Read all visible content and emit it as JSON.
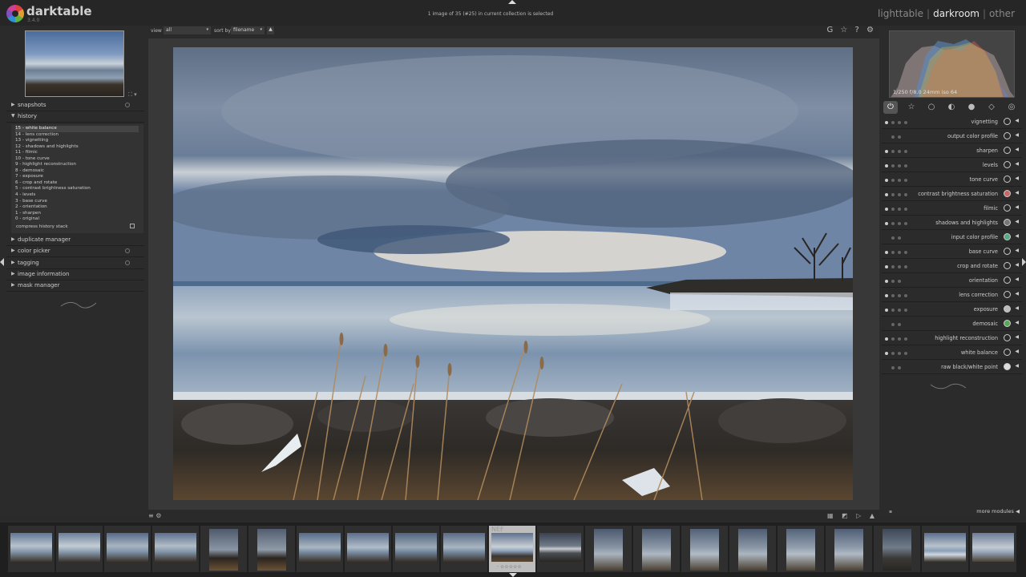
{
  "header": {
    "app_name": "darktable",
    "app_version": "3.4.0",
    "status": "1 image of 35 (#25) in current collection is selected",
    "views": [
      "lighttable",
      "darkroom",
      "other"
    ],
    "active_view": "darkroom"
  },
  "left_panel": {
    "snapshots_label": "snapshots",
    "history_label": "history",
    "history_items": [
      "15 - white balance",
      "14 - lens correction",
      "13 - vignetting",
      "12 - shadows and highlights",
      "11 - filmic",
      "10 - tone curve",
      "9 - highlight reconstruction",
      "8 - demosaic",
      "7 - exposure",
      "6 - crop and rotate",
      "5 - contrast brightness saturation",
      "4 - levels",
      "3 - base curve",
      "2 - orientation",
      "1 - sharpen",
      "0 - original"
    ],
    "compress_label": "compress history stack",
    "modules": [
      "duplicate manager",
      "color picker",
      "tagging",
      "image information",
      "mask manager"
    ]
  },
  "topbar": {
    "view_label": "view",
    "view_value": "all",
    "sort_label": "sort by",
    "sort_value": "filename",
    "sort_order": "▲",
    "right_icons": "G ☆ ? ⚙"
  },
  "right_panel": {
    "histogram_info": "1/250 f/8.0 24mm iso 64",
    "modules": [
      {
        "name": "vignetting",
        "power": true
      },
      {
        "name": "output color profile",
        "power": false
      },
      {
        "name": "sharpen",
        "power": true
      },
      {
        "name": "levels",
        "power": true
      },
      {
        "name": "tone curve",
        "power": true
      },
      {
        "name": "contrast brightness saturation",
        "power": true
      },
      {
        "name": "filmic",
        "power": true
      },
      {
        "name": "shadows and highlights",
        "power": true
      },
      {
        "name": "input color profile",
        "power": false
      },
      {
        "name": "base curve",
        "power": true
      },
      {
        "name": "crop and rotate",
        "power": true
      },
      {
        "name": "orientation",
        "power": true
      },
      {
        "name": "lens correction",
        "power": true
      },
      {
        "name": "exposure",
        "power": true
      },
      {
        "name": "demosaic",
        "power": false
      },
      {
        "name": "highlight reconstruction",
        "power": true
      },
      {
        "name": "white balance",
        "power": true
      },
      {
        "name": "raw black/white point",
        "power": false
      }
    ],
    "more_modules": "more modules"
  },
  "filmstrip": {
    "current_label": "NEF",
    "current_stars": "· ☆☆☆☆☆"
  },
  "colors": {
    "background": "#2a2a2a",
    "panel": "#2b2b2b",
    "center_bg": "#383838",
    "filmstrip_bg": "#1f1f1f",
    "accent_active_view": "#e8e8e8"
  }
}
